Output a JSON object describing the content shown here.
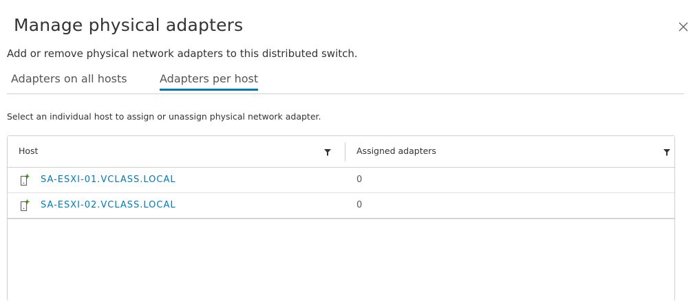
{
  "dialog": {
    "title": "Manage physical adapters",
    "subtitle": "Add or remove physical network adapters to this distributed switch.",
    "tabs": [
      {
        "label": "Adapters on all hosts",
        "active": false
      },
      {
        "label": "Adapters per host",
        "active": true
      }
    ],
    "hint": "Select an individual host to assign or unassign physical network adapter.",
    "grid": {
      "columns": [
        "Host",
        "Assigned adapters"
      ],
      "rows": [
        {
          "host": "SA-ESXI-01.VCLASS.LOCAL",
          "assigned": "0"
        },
        {
          "host": "SA-ESXI-02.VCLASS.LOCAL",
          "assigned": "0"
        }
      ]
    }
  },
  "icons": {
    "close": "close-icon",
    "filter": "filter-icon",
    "host": "host-icon"
  },
  "colors": {
    "accent": "#0079b8",
    "link": "#0079b8",
    "border": "#cfcfcf",
    "host_icon_plus": "#2f8400"
  }
}
